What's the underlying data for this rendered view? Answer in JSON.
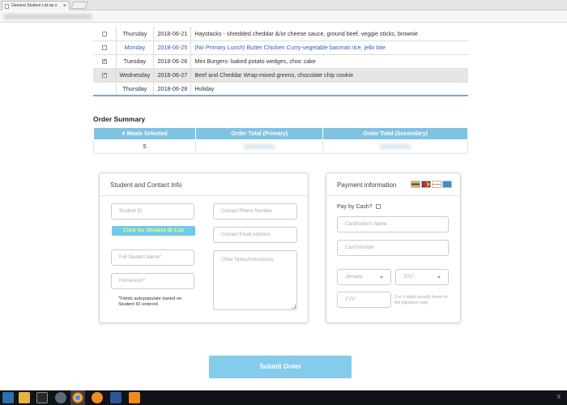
{
  "browser": {
    "tab_title": "General Student List as o",
    "tab_close": "×"
  },
  "meals": [
    {
      "checked": false,
      "day": "Thursday",
      "date": "2018-06-21",
      "menu": "Haystacks - shredded cheddar &/or cheese sauce, ground beef, veggie sticks, brownie",
      "style": "normal"
    },
    {
      "checked": false,
      "day": "Monday",
      "date": "2018-06-25",
      "menu": "(No Primary Lunch) Butter Chicken Curry-vegetable basmati rice, jello bite",
      "style": "blue"
    },
    {
      "checked": true,
      "day": "Tuesday",
      "date": "2018-06-26",
      "menu": "Mini Burgers- baked potato wedges, choc cake",
      "style": "normal"
    },
    {
      "checked": true,
      "day": "Wednesday",
      "date": "2018-06-27",
      "menu": "Beef and Cheddar Wrap-mixed greens, chocolate chip cookie",
      "style": "highlight"
    },
    {
      "checked": null,
      "day": "Thursday",
      "date": "2018-06-28",
      "menu": "Holiday",
      "style": "normal"
    }
  ],
  "summary": {
    "title": "Order Summary",
    "headers": [
      "# Meals Selected",
      "Order Total (Primary)",
      "Order Total (Secondary)"
    ],
    "meals_selected": "5"
  },
  "student": {
    "title": "Student and Contact Info",
    "student_id_placeholder": "Student ID",
    "lookup_label": "Click for Student ID List",
    "full_name_placeholder": "Full Student Name*",
    "homeroom_placeholder": "Homeroom*",
    "note": "*Fields autopopulate based on Student ID entered.",
    "phone_placeholder": "Contact Phone Number",
    "email_placeholder": "Contact Email Address",
    "notes_placeholder": "Other Notes/Instructions"
  },
  "payment": {
    "title": "Payment information",
    "pay_cash_label": "Pay by Cash?",
    "cardholder_placeholder": "Cardholder's Name",
    "card_number_placeholder": "Card Number",
    "month_value": "January",
    "year_value": "2017",
    "cvv_placeholder": "CVV",
    "cvv_hint": "3 or 4 digits usually found on the signature strip"
  },
  "submit_label": "Submit Order",
  "taskbar": {
    "tray_text": "ℛ"
  },
  "colors": {
    "accent": "#7fc3e3",
    "submit": "#85cbeb",
    "lookup_text": "#ffff66",
    "link_blue": "#2d5fb3"
  }
}
